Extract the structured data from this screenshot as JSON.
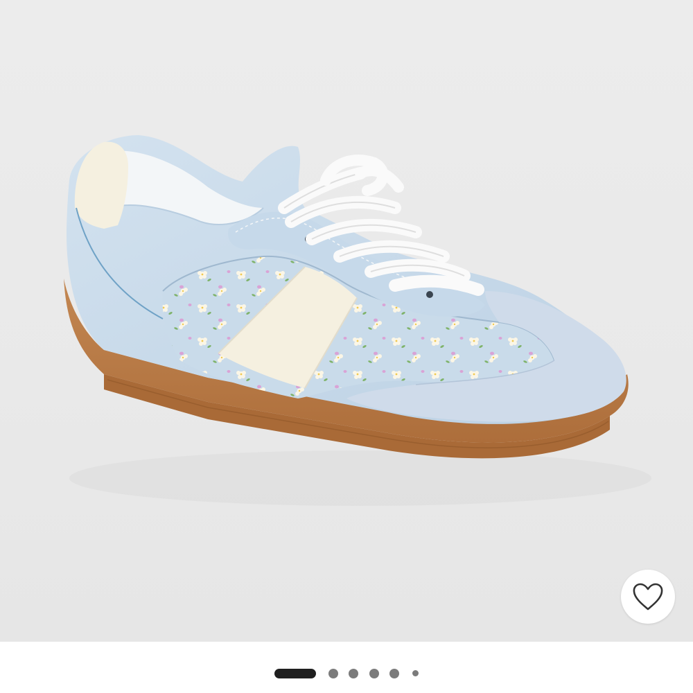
{
  "gallery": {
    "image_icon": "sneaker-product-photo",
    "slide_count": 6,
    "active_slide": 1,
    "colors": {
      "background": "#ebebeb",
      "upper": "#c9dbea",
      "stripe": "#f4f0e2",
      "sole": "#b97a45",
      "suede": "#cdd9e8"
    }
  },
  "favorite": {
    "icon": "heart-outline-icon",
    "color": "#333333"
  },
  "pager": {
    "active_color": "#1f1f1f",
    "inactive_color": "#7b7b7b"
  }
}
